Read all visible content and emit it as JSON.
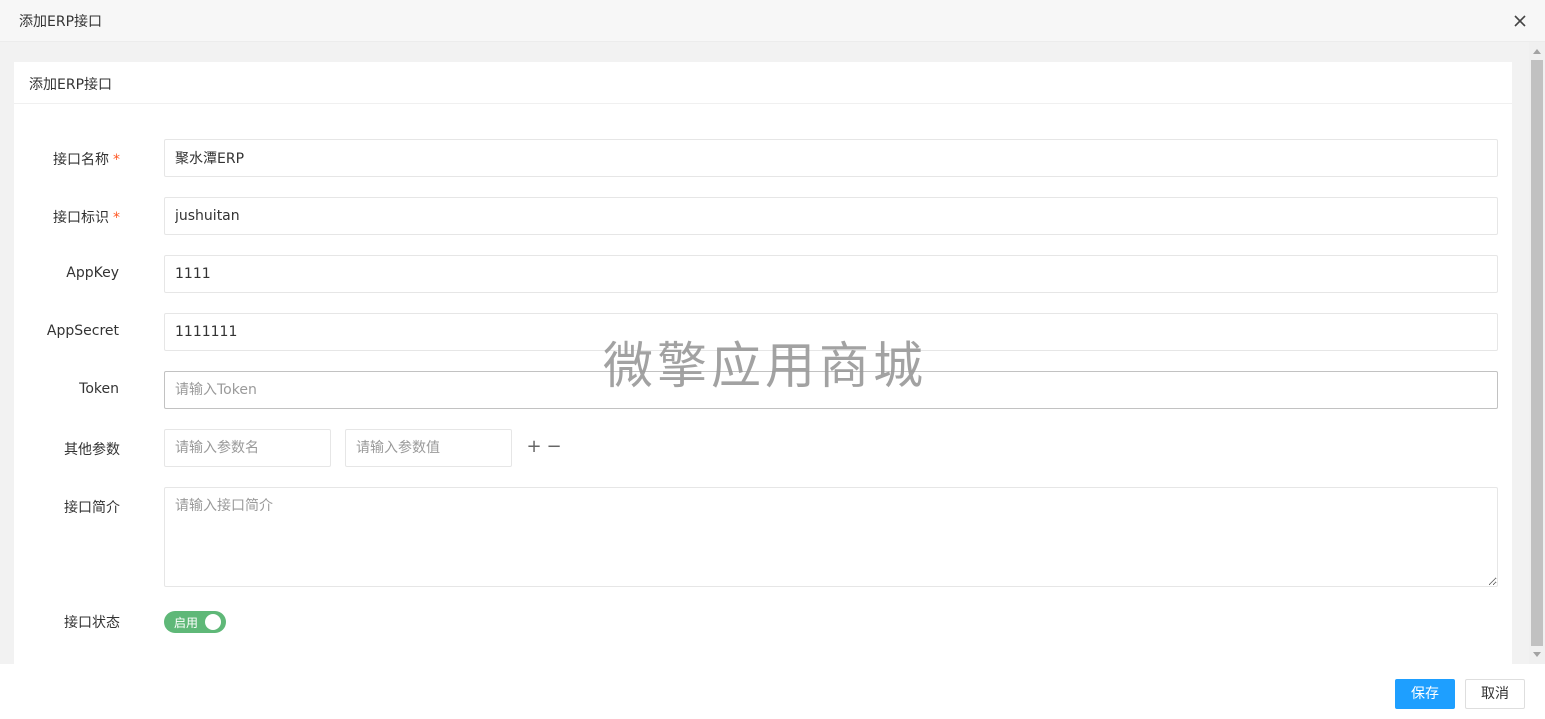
{
  "window": {
    "title": "添加ERP接口"
  },
  "card": {
    "title": "添加ERP接口"
  },
  "form": {
    "name": {
      "label": "接口名称",
      "required": "*",
      "value": "聚水潭ERP"
    },
    "identifier": {
      "label": "接口标识",
      "required": "*",
      "value": "jushuitan"
    },
    "appkey": {
      "label": "AppKey",
      "value": "1111"
    },
    "appsecret": {
      "label": "AppSecret",
      "value": "1111111"
    },
    "token": {
      "label": "Token",
      "value": "",
      "placeholder": "请输入Token"
    },
    "other_params": {
      "label": "其他参数",
      "name_placeholder": "请输入参数名",
      "value_placeholder": "请输入参数值",
      "add_symbol": "+",
      "remove_symbol": "−"
    },
    "description": {
      "label": "接口简介",
      "value": "",
      "placeholder": "请输入接口简介"
    },
    "status": {
      "label": "接口状态",
      "switch_text": "启用",
      "enabled": true
    }
  },
  "watermark": "微擎应用商城",
  "footer": {
    "save_label": "保存",
    "cancel_label": "取消"
  },
  "icons": {
    "close": "close-icon"
  },
  "colors": {
    "primary": "#1e9fff",
    "switch_on": "#5fb878",
    "required": "#ff5722"
  }
}
